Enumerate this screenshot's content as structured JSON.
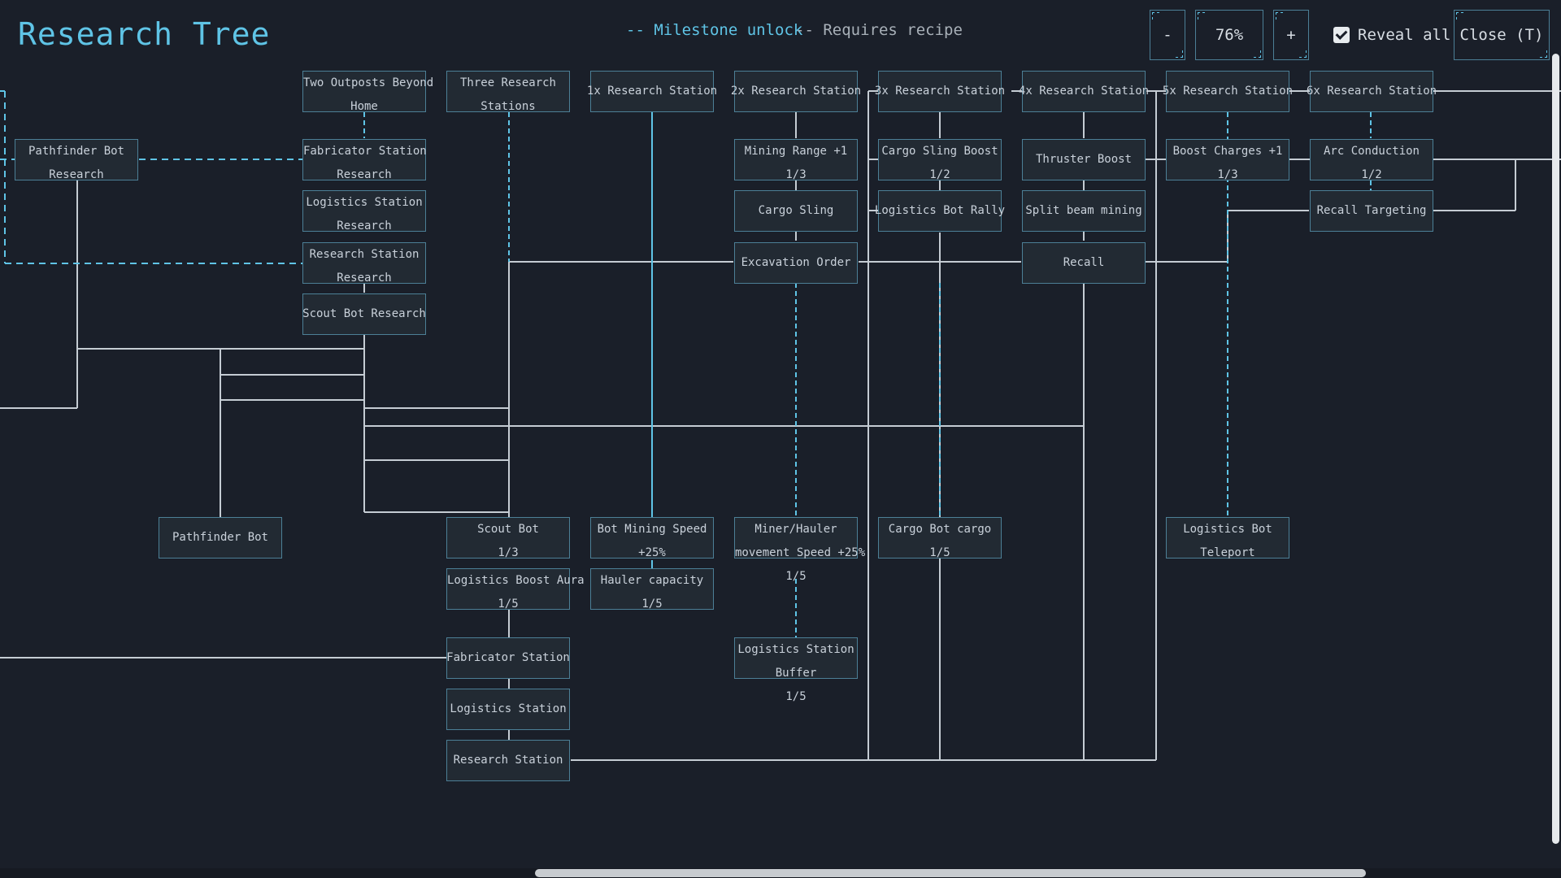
{
  "header": {
    "title": "Research Tree",
    "legend_milestone": "-- Milestone unlock",
    "legend_recipe": "-- Requires recipe"
  },
  "controls": {
    "zoom_out": "-",
    "zoom_level": "76%",
    "zoom_in": "+",
    "reveal_all": "Reveal all",
    "reveal_all_checked": true,
    "close": "Close (T)"
  },
  "colors": {
    "background": "#1a1f29",
    "accent": "#5fc4e6",
    "node_border": "#4c7f96",
    "connector": "#c5ccd3"
  },
  "nodes": {
    "two_outposts": {
      "line1": "Two Outposts Beyond",
      "line2": "Home"
    },
    "three_research_stations": {
      "line1": "Three Research",
      "line2": "Stations"
    },
    "research_station_1x": {
      "line1": "1x Research Station"
    },
    "research_station_2x": {
      "line1": "2x Research Station"
    },
    "research_station_3x": {
      "line1": "3x Research Station"
    },
    "research_station_4x": {
      "line1": "4x Research Station"
    },
    "research_station_5x": {
      "line1": "5x Research Station"
    },
    "research_station_6x": {
      "line1": "6x Research Station"
    },
    "pathfinder_bot_research": {
      "line1": "Pathfinder Bot",
      "line2": "Research"
    },
    "fabricator_station_research": {
      "line1": "Fabricator Station",
      "line2": "Research"
    },
    "logistics_station_research": {
      "line1": "Logistics Station",
      "line2": "Research"
    },
    "research_station_research": {
      "line1": "Research Station",
      "line2": "Research"
    },
    "scout_bot_research": {
      "line1": "Scout Bot Research"
    },
    "mining_range": {
      "line1": "Mining Range +1",
      "line2": "1/3"
    },
    "cargo_sling": {
      "line1": "Cargo Sling"
    },
    "excavation_order": {
      "line1": "Excavation Order"
    },
    "cargo_sling_boost": {
      "line1": "Cargo Sling Boost",
      "line2": "1/2"
    },
    "logistics_bot_rally": {
      "line1": "Logistics Bot Rally"
    },
    "thruster_boost": {
      "line1": "Thruster Boost"
    },
    "split_beam_mining": {
      "line1": "Split beam mining"
    },
    "recall": {
      "line1": "Recall"
    },
    "boost_charges": {
      "line1": "Boost Charges +1",
      "line2": "1/3"
    },
    "arc_conduction": {
      "line1": "Arc Conduction",
      "line2": "1/2"
    },
    "recall_targeting": {
      "line1": "Recall Targeting"
    },
    "pathfinder_bot": {
      "line1": "Pathfinder Bot"
    },
    "scout_bot": {
      "line1": "Scout Bot",
      "line2": "1/3"
    },
    "logistics_boost_aura": {
      "line1": "Logistics Boost Aura",
      "line2": "1/5"
    },
    "fabricator_station": {
      "line1": "Fabricator Station"
    },
    "logistics_station": {
      "line1": "Logistics Station"
    },
    "research_station": {
      "line1": "Research Station"
    },
    "bot_mining_speed": {
      "line1": "Bot Mining Speed",
      "line2": "+25%"
    },
    "hauler_capacity": {
      "line1": "Hauler capacity",
      "line2": "1/5"
    },
    "miner_hauler_speed": {
      "line1": "Miner/Hauler",
      "line2": "movement Speed +25%",
      "line3": "1/5"
    },
    "logistics_station_buffer": {
      "line1": "Logistics Station",
      "line2": "Buffer",
      "line3": "1/5"
    },
    "cargo_bot_cargo": {
      "line1": "Cargo Bot cargo",
      "line2": "1/5"
    },
    "logistics_bot_teleport": {
      "line1": "Logistics Bot",
      "line2": "Teleport"
    }
  }
}
